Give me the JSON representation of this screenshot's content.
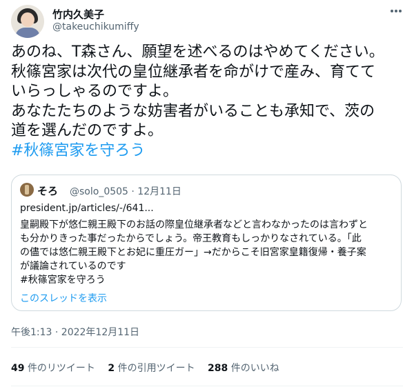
{
  "author": {
    "name": "竹内久美子",
    "handle": "@takeuchikumiffy"
  },
  "tweet": {
    "text": "あのね、T森さん、願望を述べるのはやめてください。\n秋篠宮家は次代の皇位継承者を命がけで産み、育てて\nいらっしゃるのですよ。\nあなたたちのような妨害者がいることも承知で、茨の\n道を選んだのですよ。",
    "hashtag": "#秋篠宮家を守ろう"
  },
  "quoted": {
    "name": "そろ",
    "meta": "@solo_0505 · 12月11日",
    "link": "president.jp/articles/-/641...",
    "text": "皇嗣殿下が悠仁親王殿下のお話の際皇位継承者などと言わなかったのは言わずと\nも分かりきった事だったからでしょう。帝王教育もしっかりなされている。「此\nの儘では悠仁親王殿下とお妃に重圧ガー」→だからこそ旧宮家皇籍復帰・養子案\nが議論されているのです\n#秋篠宮家を守ろう",
    "show_thread": "このスレッドを表示"
  },
  "timestamp": "午後1:13 · 2022年12月11日",
  "stats": {
    "retweets_count": "49",
    "retweets_label": "件のリツイート",
    "quotes_count": "2",
    "quotes_label": "件の引用ツイート",
    "likes_count": "288",
    "likes_label": "件のいいね"
  },
  "colors": {
    "accent": "#1d9bf0",
    "secondary_text": "#536471",
    "border": "#cfd9de"
  },
  "icons": [
    "more-icon"
  ]
}
